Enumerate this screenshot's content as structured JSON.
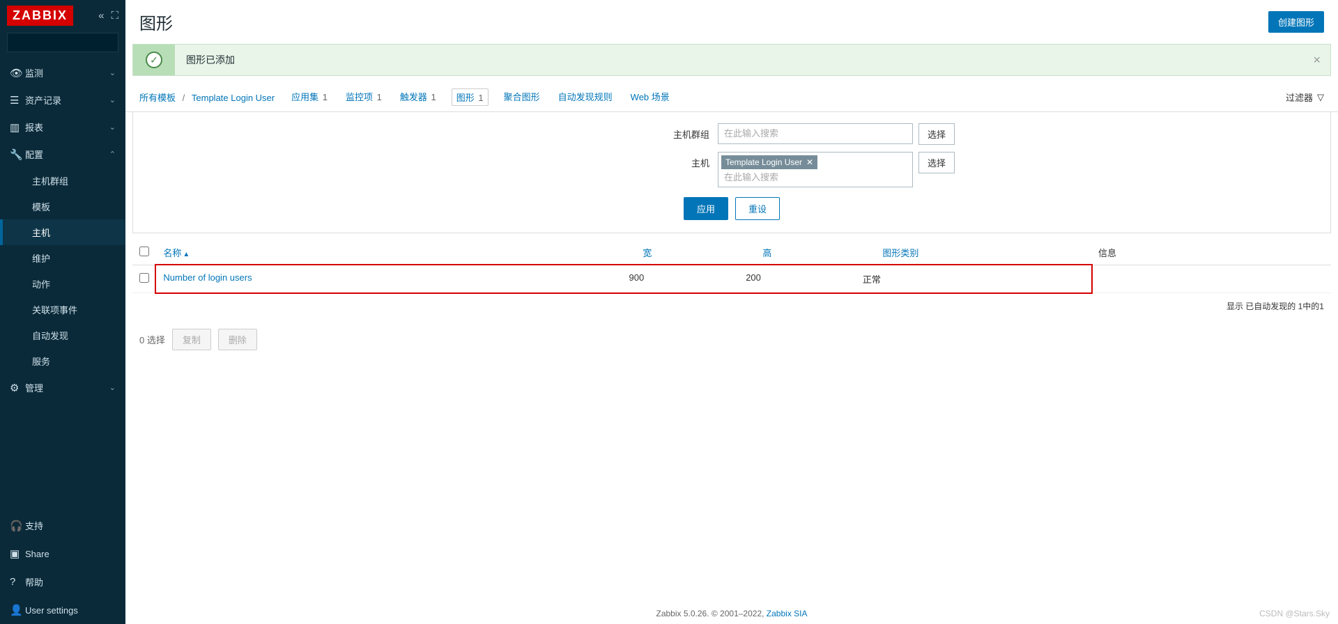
{
  "logo": "ZABBIX",
  "page_title": "图形",
  "create_button": "创建图形",
  "message": "图形已添加",
  "breadcrumb": {
    "all_templates": "所有模板",
    "template": "Template Login User"
  },
  "tabs": {
    "app": {
      "label": "应用集",
      "count": "1"
    },
    "items": {
      "label": "监控项",
      "count": "1"
    },
    "triggers": {
      "label": "触发器",
      "count": "1"
    },
    "graphs": {
      "label": "图形",
      "count": "1"
    },
    "agg": {
      "label": "聚合图形"
    },
    "discovery": {
      "label": "自动发现规则"
    },
    "web": {
      "label": "Web 场景"
    }
  },
  "filter_btn": "过滤器",
  "filter": {
    "hostgroup_label": "主机群组",
    "host_label": "主机",
    "placeholder": "在此输入搜索",
    "select_btn": "选择",
    "host_tag": "Template Login User",
    "apply": "应用",
    "reset": "重设"
  },
  "columns": {
    "name": "名称",
    "width": "宽",
    "height": "高",
    "type": "图形类别",
    "info": "信息"
  },
  "row": {
    "name": "Number of login users",
    "width": "900",
    "height": "200",
    "type": "正常"
  },
  "table_footer": "显示 已自动发现的 1中的1",
  "bulk": {
    "selected": "0 选择",
    "copy": "复制",
    "delete": "删除"
  },
  "nav": {
    "monitoring": "监测",
    "inventory": "资产记录",
    "reports": "报表",
    "config": "配置",
    "admin": "管理",
    "support": "支持",
    "share": "Share",
    "help": "帮助",
    "user": "User settings",
    "sub": {
      "hostgroups": "主机群组",
      "templates": "模板",
      "hosts": "主机",
      "maintenance": "维护",
      "actions": "动作",
      "correlation": "关联项事件",
      "discovery": "自动发现",
      "services": "服务"
    }
  },
  "footer": {
    "text": "Zabbix 5.0.26. © 2001–2022, ",
    "link": "Zabbix SIA"
  },
  "watermark": "CSDN @Stars.Sky"
}
